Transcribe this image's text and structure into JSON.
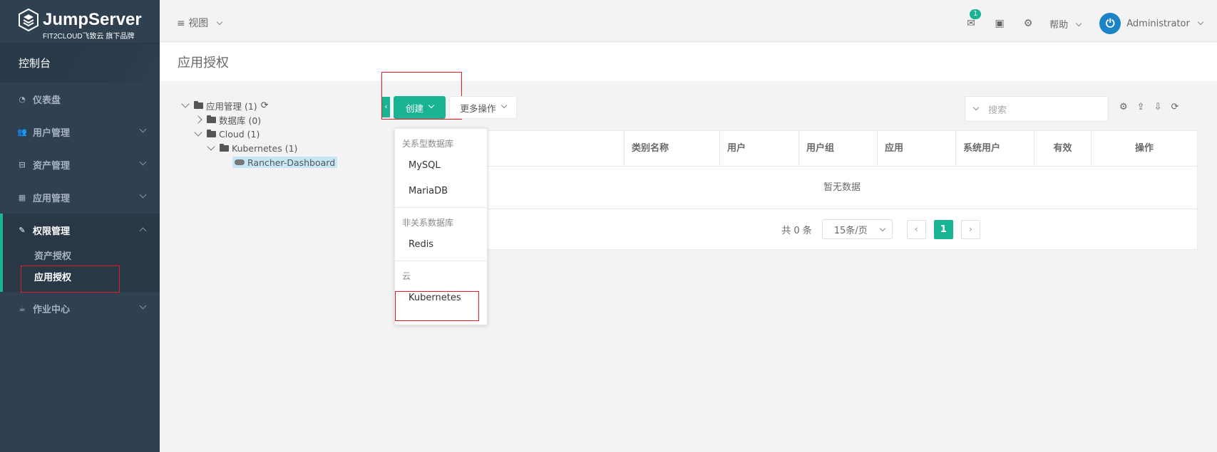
{
  "brand": {
    "name": "JumpServer",
    "tagline": "FIT2CLOUD飞致云 旗下品牌"
  },
  "sidebar": {
    "console": "控制台",
    "items": [
      {
        "label": "仪表盘",
        "icon": "dashboard-icon"
      },
      {
        "label": "用户管理",
        "icon": "users-icon"
      },
      {
        "label": "资产管理",
        "icon": "inbox-icon"
      },
      {
        "label": "应用管理",
        "icon": "grid-icon"
      },
      {
        "label": "权限管理",
        "icon": "edit-icon"
      },
      {
        "label": "作业中心",
        "icon": "coffee-icon"
      }
    ],
    "sub_items": [
      "资产授权",
      "应用授权"
    ]
  },
  "topbar": {
    "view": "视图",
    "mail_badge": "1",
    "help": "帮助",
    "user": "Administrator"
  },
  "page": {
    "title": "应用授权"
  },
  "tree": {
    "root": "应用管理 (1)",
    "database": "数据库 (0)",
    "cloud": "Cloud (1)",
    "kubernetes": "Kubernetes (1)",
    "leaf": "Rancher-Dashboard"
  },
  "toolbar": {
    "collapse": "‹",
    "create": "创建",
    "more": "更多操作",
    "search_placeholder": "搜索"
  },
  "table": {
    "columns": [
      "",
      "类别名称",
      "用户",
      "用户组",
      "应用",
      "系统用户",
      "有效",
      "操作"
    ],
    "empty": "暂无数据"
  },
  "pagination": {
    "total": "共 0 条",
    "page_size": "15条/页",
    "prev": "‹",
    "current": "1",
    "next": "›"
  },
  "dropdown": {
    "group1": "关系型数据库",
    "mysql": "MySQL",
    "mariadb": "MariaDB",
    "group2": "非关系数据库",
    "redis": "Redis",
    "group3": "云",
    "kubernetes": "Kubernetes"
  },
  "colors": {
    "accent": "#1ab394",
    "sidebar": "#2f4050",
    "highlight": "#e51c23"
  }
}
